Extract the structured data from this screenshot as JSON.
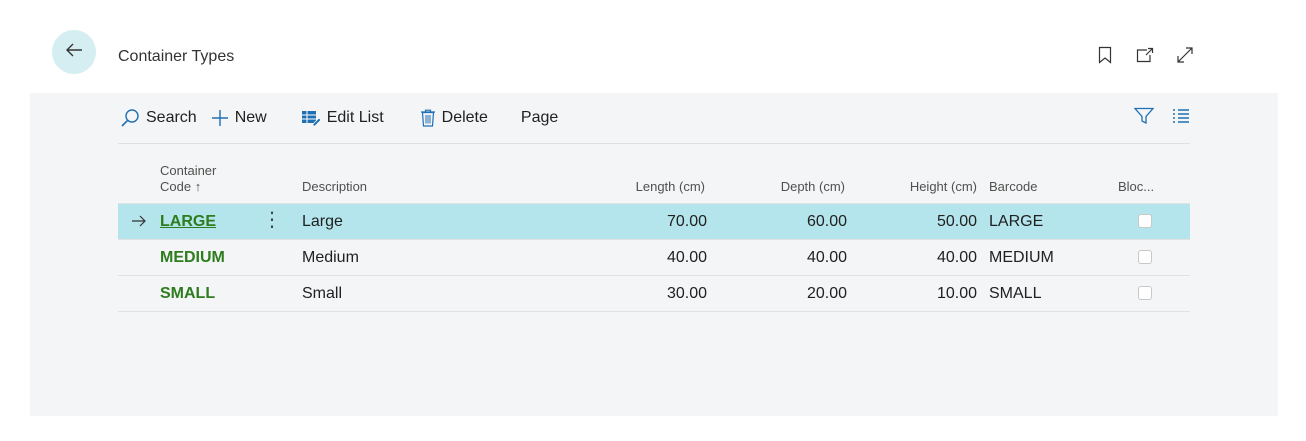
{
  "header": {
    "title": "Container Types"
  },
  "toolbar": {
    "search_label": "Search",
    "new_label": "New",
    "edit_list_label": "Edit List",
    "delete_label": "Delete",
    "page_label": "Page"
  },
  "table": {
    "columns": {
      "code_line1": "Container",
      "code_line2": "Code ↑",
      "description": "Description",
      "length": "Length (cm)",
      "depth": "Depth (cm)",
      "height": "Height (cm)",
      "barcode": "Barcode",
      "blocked": "Bloc..."
    },
    "rows": [
      {
        "code": "LARGE",
        "description": "Large",
        "length": "70.00",
        "depth": "60.00",
        "height": "50.00",
        "barcode": "LARGE",
        "blocked": false
      },
      {
        "code": "MEDIUM",
        "description": "Medium",
        "length": "40.00",
        "depth": "40.00",
        "height": "40.00",
        "barcode": "MEDIUM",
        "blocked": false
      },
      {
        "code": "SMALL",
        "description": "Small",
        "length": "30.00",
        "depth": "20.00",
        "height": "10.00",
        "barcode": "SMALL",
        "blocked": false
      }
    ]
  },
  "colors": {
    "accent": "#2d7d1e",
    "selected_row": "#b4e5ec",
    "back_button": "#d4eef2",
    "icon_blue": "#1f6fb2"
  },
  "icons": [
    "back-arrow-icon",
    "bookmark-icon",
    "open-in-new-window-icon",
    "expand-icon",
    "search-icon",
    "plus-icon",
    "edit-list-icon",
    "delete-icon",
    "filter-icon",
    "list-view-icon",
    "current-row-arrow-icon",
    "row-actions-icon"
  ]
}
